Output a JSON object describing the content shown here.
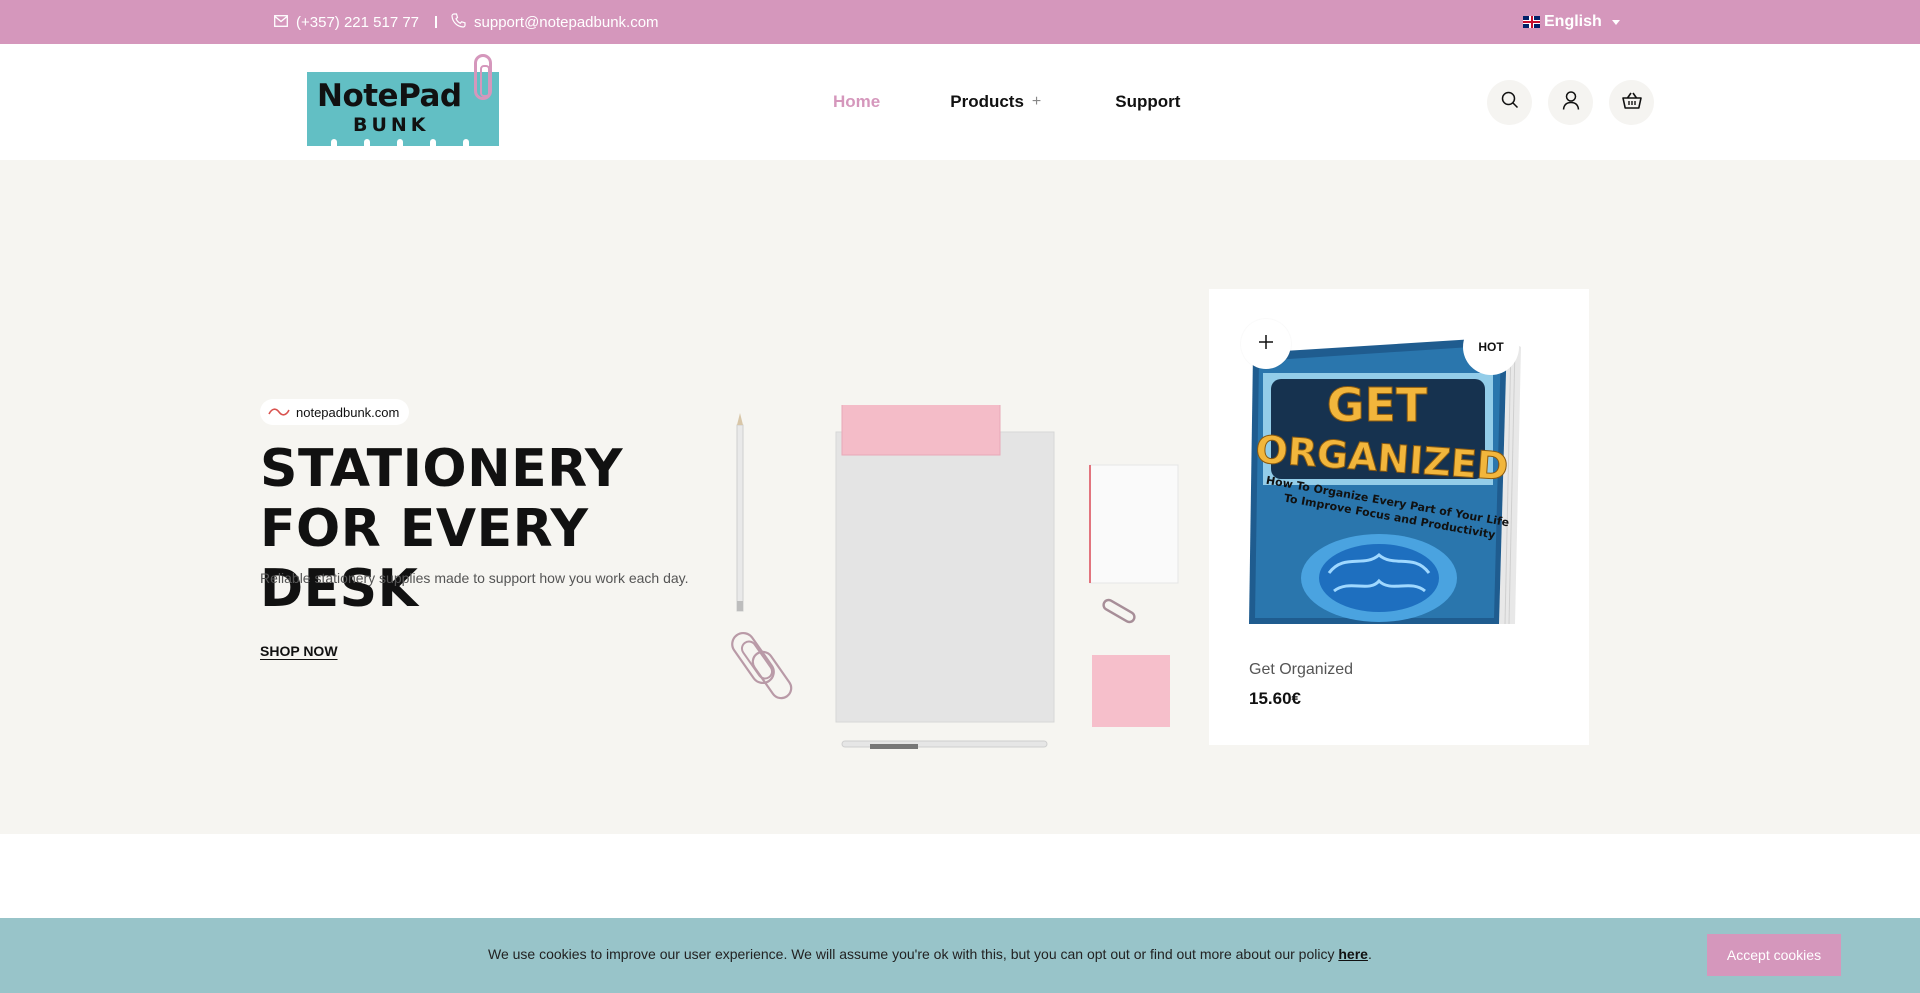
{
  "topbar": {
    "phone": "(+357) 221 517 77",
    "email": "support@notepadbunk.com",
    "language": "English",
    "background_color": "#d597bc"
  },
  "header": {
    "logo": {
      "line1": "NotePad",
      "line2": "BUNK"
    },
    "nav": [
      {
        "label": "Home",
        "active": true
      },
      {
        "label": "Products",
        "has_submenu": true
      },
      {
        "label": "Support"
      }
    ],
    "actions": [
      "search-icon",
      "user-icon",
      "basket-icon"
    ]
  },
  "hero": {
    "badge": "notepadbunk.com",
    "title": "STATIONERY FOR EVERY DESK",
    "subtitle": "Reliable stationery supplies made to support how you work each day.",
    "cta": "SHOP NOW",
    "background_color": "#f6f5f1"
  },
  "product": {
    "badge": "HOT",
    "name": "Get Organized",
    "price": "15.60€",
    "cover": {
      "title_line1": "GET",
      "title_line2": "ORGANIZED",
      "subtitle_line1": "How To Organize Every Part of Your Life",
      "subtitle_line2": "To Improve Focus and Productivity"
    }
  },
  "cookie": {
    "message": "We use cookies to improve our user experience. We will assume you're ok with this, but you can opt out or find out more about our policy ",
    "link": "here",
    "after_link": ".",
    "accept_label": "Accept cookies",
    "background_color": "#98c4c9",
    "button_color": "#d597bc"
  }
}
